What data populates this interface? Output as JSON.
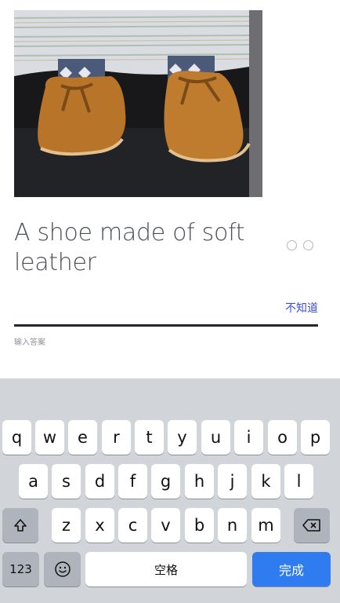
{
  "question": {
    "text": "A shoe made of soft leather"
  },
  "actions": {
    "dont_know": "不知道"
  },
  "input": {
    "hint": "输入答案"
  },
  "keyboard": {
    "row1": [
      "q",
      "w",
      "e",
      "r",
      "t",
      "y",
      "u",
      "i",
      "o",
      "p"
    ],
    "row2": [
      "a",
      "s",
      "d",
      "f",
      "g",
      "h",
      "j",
      "k",
      "l"
    ],
    "row3": [
      "z",
      "x",
      "c",
      "v",
      "b",
      "n",
      "m"
    ],
    "numbers_label": "123",
    "space_label": "空格",
    "done_label": "完成"
  },
  "icons": {
    "shift": "shift-icon",
    "backspace": "backspace-icon",
    "emoji": "emoji-icon",
    "progress": "progress-dot-icon"
  }
}
